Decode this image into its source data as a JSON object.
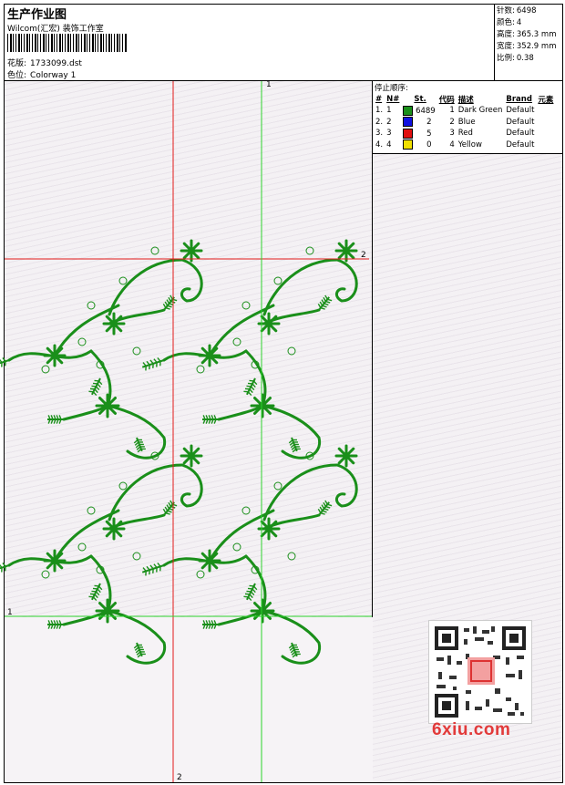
{
  "header": {
    "title": "生产作业图",
    "company": "Wilcom(汇宏) 装饰工作室",
    "design_label": "花版:",
    "design_value": "1733099.dst",
    "colorway_label": "色位:",
    "colorway_value": "Colorway 1"
  },
  "stats": [
    {
      "label": "针数:",
      "value": "6498"
    },
    {
      "label": "颜色:",
      "value": "4"
    },
    {
      "label": "高度:",
      "value": "365.3 mm"
    },
    {
      "label": "宽度:",
      "value": "352.9 mm"
    },
    {
      "label": "比例:",
      "value": "0.38"
    }
  ],
  "stop_sequence": {
    "title": "停止顺序:",
    "columns": [
      "#",
      "N#",
      "St.",
      "代码",
      "描述",
      "Brand",
      "元素"
    ],
    "rows": [
      {
        "idx": "1.",
        "n": "1",
        "color": "#1a8f1a",
        "st": "6489",
        "code": "1",
        "desc": "Dark Green",
        "brand": "Default"
      },
      {
        "idx": "2.",
        "n": "2",
        "color": "#1010e0",
        "st": "2",
        "code": "2",
        "desc": "Blue",
        "brand": "Default"
      },
      {
        "idx": "3.",
        "n": "3",
        "color": "#e01010",
        "st": "5",
        "code": "3",
        "desc": "Red",
        "brand": "Default"
      },
      {
        "idx": "4.",
        "n": "4",
        "color": "#f0e000",
        "st": "0",
        "code": "4",
        "desc": "Yellow",
        "brand": "Default"
      }
    ]
  },
  "guides": {
    "green_label_top": "1",
    "green_label_left": "1",
    "red_label_right": "2",
    "red_label_bottom": "2",
    "green_color": "#2bd42b",
    "red_color": "#e21a1a"
  },
  "embroidery_color": "#1a8f1a",
  "watermark": "6xiu.com"
}
